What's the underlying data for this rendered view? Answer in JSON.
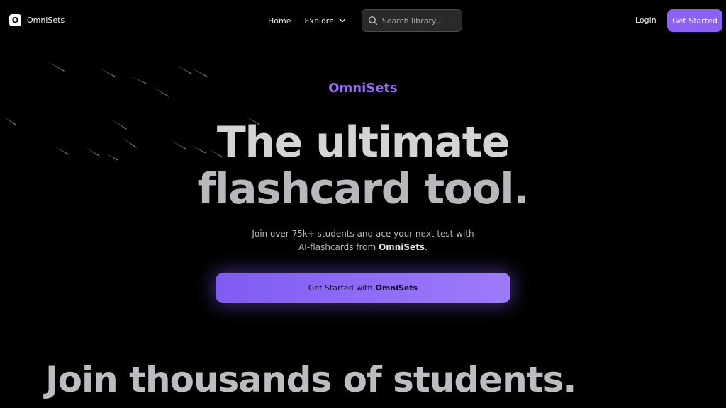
{
  "nav": {
    "logo_letter": "O",
    "brand": "OmniSets",
    "home": "Home",
    "explore": "Explore",
    "search_placeholder": "Search library...",
    "login": "Login",
    "get_started": "Get Started"
  },
  "hero": {
    "eyebrow": "OmniSets",
    "headline_line1": "The ultimate",
    "headline_line2": "flashcard tool.",
    "sub_line1": "Join over 75k+ students and ace your next test with",
    "sub_line2_prefix": "AI-flashcards from",
    "sub_line2_brand": "OmniSets",
    "sub_line2_suffix": ".",
    "cta_prefix": "Get Started with",
    "cta_brand": "OmniSets"
  },
  "section": {
    "title": "Join thousands of students."
  },
  "colors": {
    "accent": "#8b62f5",
    "eyebrow": "#9a6cf6",
    "background": "#000000"
  },
  "icons": [
    "search-icon",
    "chevron-down-icon"
  ]
}
